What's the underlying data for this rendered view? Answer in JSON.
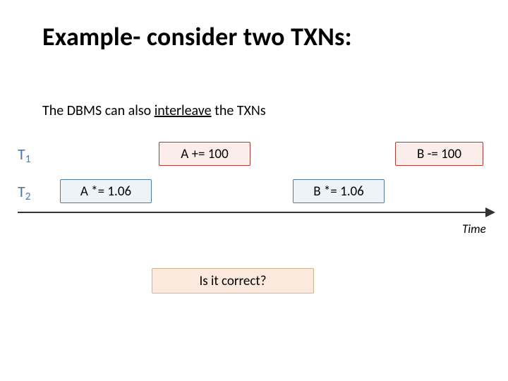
{
  "title": "Example- consider two TXNs:",
  "subtitle_pre": "The DBMS can also ",
  "subtitle_underlined": "interleave",
  "subtitle_post": " the TXNs",
  "rows": {
    "t1": {
      "label": "T",
      "sub": "1"
    },
    "t2": {
      "label": "T",
      "sub": "2"
    }
  },
  "ops": {
    "t1_a": "A += 100",
    "t1_b": "B -= 100",
    "t2_a": "A *= 1.06",
    "t2_b": "B *= 1.06"
  },
  "time_label": "Time",
  "callout": "Is it correct?"
}
